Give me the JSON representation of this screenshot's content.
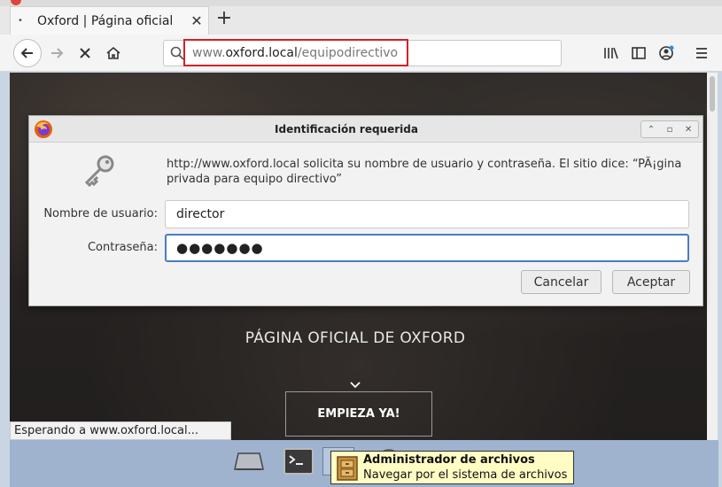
{
  "browser": {
    "tab_title": "Oxford | Página oficial",
    "tab_bullet": "•",
    "tab_close": "✕",
    "new_tab": "+",
    "url_prefix": "www.",
    "url_domain": "oxford.local",
    "url_path": "/equipodirectivo",
    "status_text": "Esperando a www.oxford.local..."
  },
  "page": {
    "hero_title": "PÁGINA OFICIAL DE OXFORD",
    "cta_label": "EMPIEZA YA!"
  },
  "dialog": {
    "title": "Identificación requerida",
    "message": "http://www.oxford.local solicita su nombre de usuario y contraseña. El sitio dice: “PÃ¡gina privada para equipo directivo”",
    "username_label": "Nombre de usuario:",
    "username_value": "director",
    "password_label": "Contraseña:",
    "password_value": "●●●●●●●",
    "cancel_label": "Cancelar",
    "accept_label": "Aceptar"
  },
  "taskbar": {
    "tooltip_title": "Administrador de archivos",
    "tooltip_desc": "Navegar por el sistema de archivos"
  },
  "colors": {
    "url_highlight": "#d61f26",
    "focus_border": "#4a7dbf",
    "tooltip_bg": "#fffcc4"
  }
}
